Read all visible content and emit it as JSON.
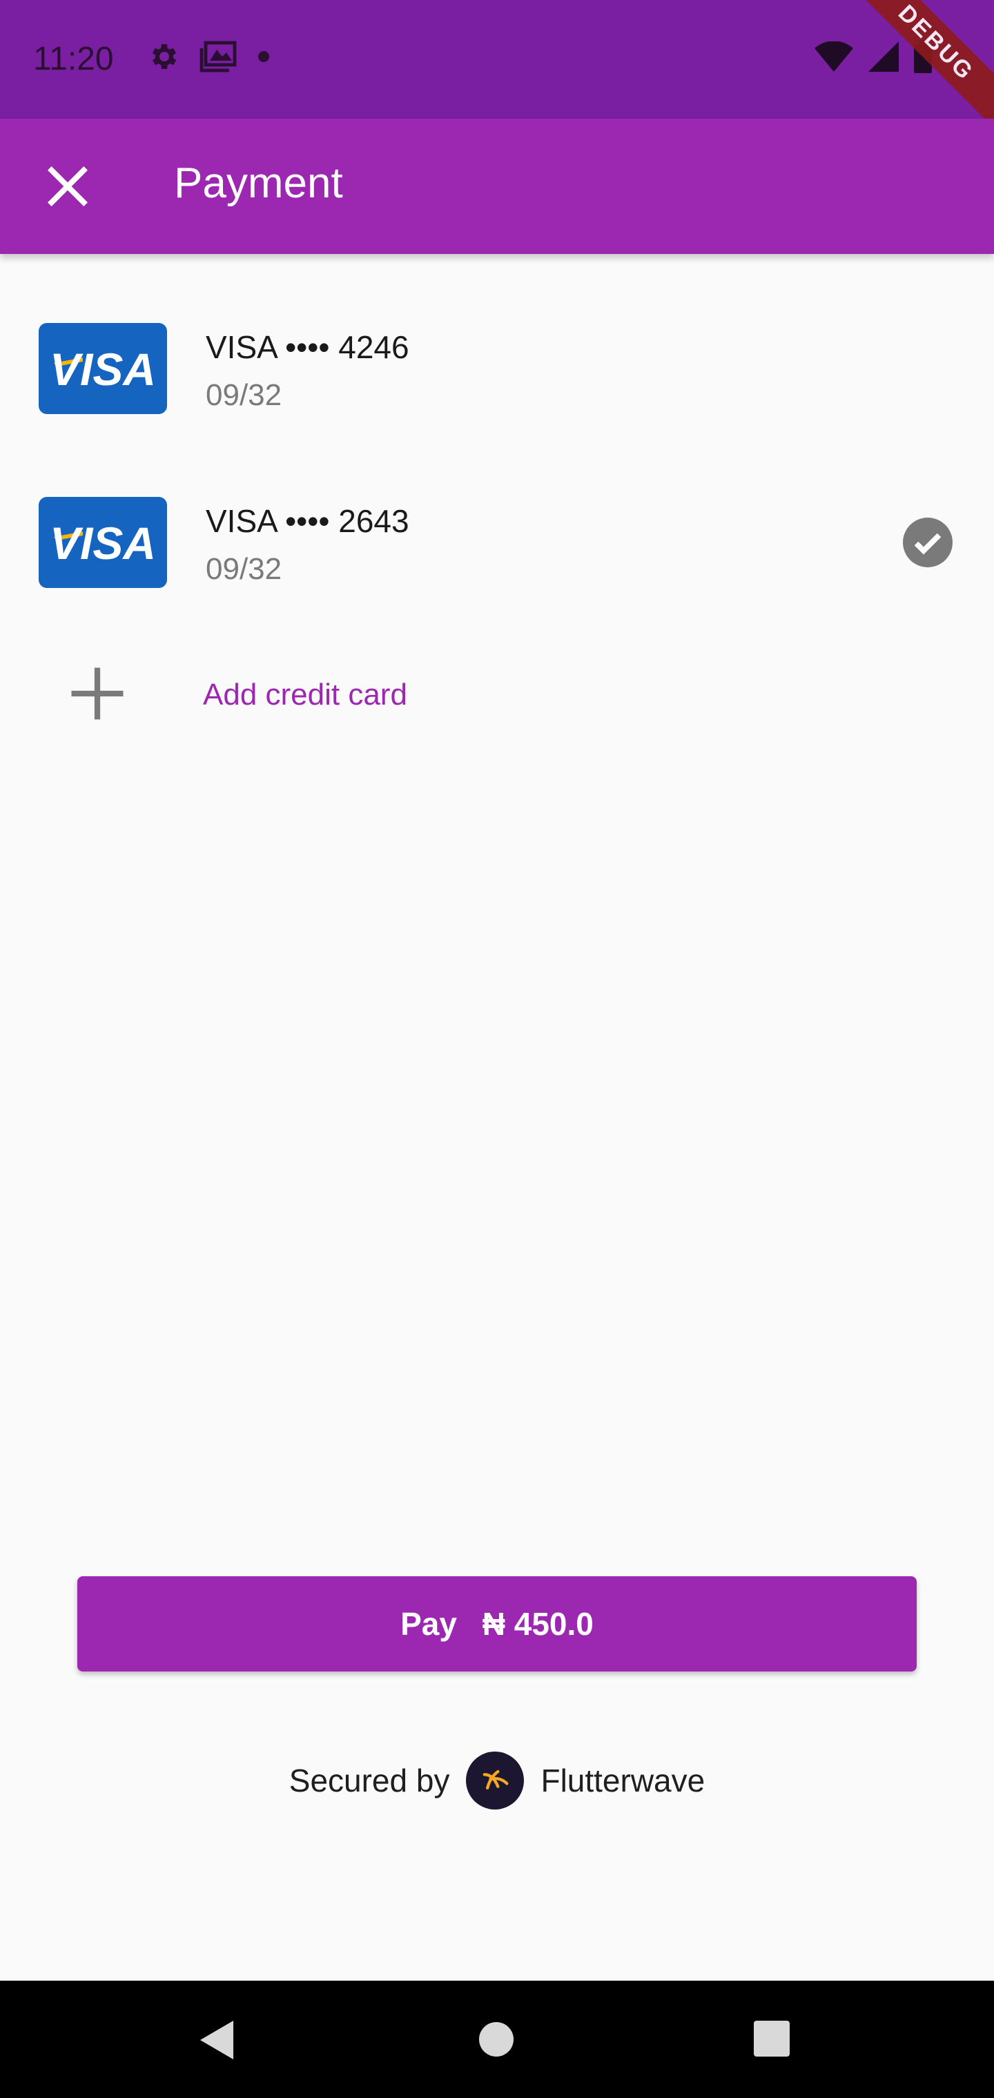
{
  "status_bar": {
    "time": "11:20",
    "left_icons": [
      "settings-icon",
      "gallery-icon",
      "dot-icon"
    ],
    "right_icons": [
      "wifi-icon",
      "signal-icon",
      "battery-icon"
    ],
    "debug_banner": "DEBUG"
  },
  "app_bar": {
    "title": "Payment",
    "close_icon": "close-icon"
  },
  "cards": [
    {
      "brand": "VISA",
      "display": "VISA •••• 4246",
      "expiry": "09/32",
      "selected": false
    },
    {
      "brand": "VISA",
      "display": "VISA •••• 2643",
      "expiry": "09/32",
      "selected": true
    }
  ],
  "add_card": {
    "label": "Add credit card",
    "icon": "plus-icon"
  },
  "pay_button": {
    "label": "Pay",
    "amount": "₦ 450.0"
  },
  "footer": {
    "secured_by": "Secured by",
    "provider": "Flutterwave"
  },
  "colors": {
    "status_bar": "#7b1fa2",
    "primary": "#9c27b0",
    "visa_blue": "#1565c0",
    "visa_gold": "#f7b600"
  },
  "nav": {
    "icons": [
      "back-icon",
      "home-icon",
      "recents-icon"
    ]
  }
}
